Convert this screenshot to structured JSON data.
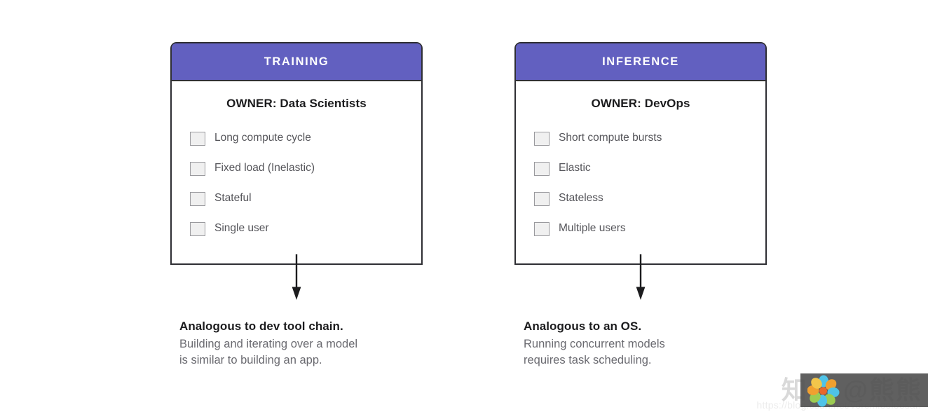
{
  "diagram": {
    "accent_color": "#6260c0",
    "border_color": "#2e2e33",
    "columns": [
      {
        "id": "training",
        "header": "TRAINING",
        "owner": "OWNER: Data Scientists",
        "items": [
          "Long compute cycle",
          "Fixed load (Inelastic)",
          "Stateful",
          "Single user"
        ],
        "caption_title": "Analogous to dev tool chain.",
        "caption_line1": "Building and iterating over a model",
        "caption_line2": "is similar to building an app."
      },
      {
        "id": "inference",
        "header": "INFERENCE",
        "owner": "OWNER: DevOps",
        "items": [
          "Short compute bursts",
          "Elastic",
          "Stateless",
          "Multiple users"
        ],
        "caption_title": "Analogous to an OS.",
        "caption_line1": "Running concurrent models",
        "caption_line2": "requires task scheduling."
      }
    ]
  },
  "watermark": {
    "site_name": "知乎 @熊熊",
    "url": "https://blog.csdn.net/vorcmlooloosan"
  }
}
